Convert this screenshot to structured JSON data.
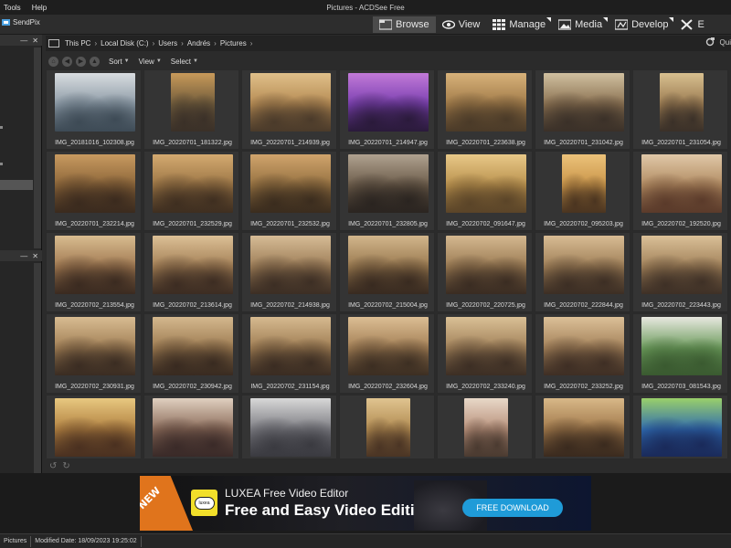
{
  "titlebar": {
    "menu": [
      "Tools",
      "Help"
    ],
    "title": "Pictures - ACDSee Free"
  },
  "toolbar": {
    "sendpix": "SendPix",
    "modes": [
      {
        "label": "Browse",
        "icon": "browse-icon",
        "active": true
      },
      {
        "label": "View",
        "icon": "eye-icon"
      },
      {
        "label": "Manage",
        "icon": "grid-icon"
      },
      {
        "label": "Media",
        "icon": "media-icon"
      },
      {
        "label": "Develop",
        "icon": "develop-icon"
      },
      {
        "label": "E",
        "icon": "edit-icon"
      }
    ]
  },
  "address": {
    "crumbs": [
      "This PC",
      "Local Disk (C:)",
      "Users",
      "Andrés",
      "Pictures"
    ],
    "quick_search": "Qui"
  },
  "nav": {
    "sort": "Sort",
    "view": "View",
    "select": "Select"
  },
  "files": [
    {
      "name": "IMG_20181016_102308.jpg",
      "orient": "land",
      "palette": [
        "#8c9aa6",
        "#d9dde0",
        "#3d4a55"
      ]
    },
    {
      "name": "IMG_20220701_181322.jpg",
      "orient": "port",
      "palette": [
        "#6e5a3a",
        "#c89a5a",
        "#3a3028"
      ]
    },
    {
      "name": "IMG_20220701_214939.jpg",
      "orient": "land",
      "palette": [
        "#b58a52",
        "#e0c08a",
        "#4a3a2a"
      ]
    },
    {
      "name": "IMG_20220701_214947.jpg",
      "orient": "land",
      "palette": [
        "#7a3fb0",
        "#c27ad8",
        "#2a1a3a"
      ]
    },
    {
      "name": "IMG_20220701_223638.jpg",
      "orient": "land",
      "palette": [
        "#a07a48",
        "#d8b27a",
        "#4a3a28"
      ]
    },
    {
      "name": "IMG_20220701_231042.jpg",
      "orient": "land",
      "palette": [
        "#8a7050",
        "#d0c0a0",
        "#3a3028"
      ]
    },
    {
      "name": "IMG_20220701_231054.jpg",
      "orient": "port",
      "palette": [
        "#9a7a50",
        "#d8c090",
        "#3a3028"
      ]
    },
    {
      "name": "IMG_20220701_232214.jpg",
      "orient": "land",
      "palette": [
        "#8a6438",
        "#c89a60",
        "#3a2a1e"
      ]
    },
    {
      "name": "IMG_20220701_232529.jpg",
      "orient": "land",
      "palette": [
        "#9a7444",
        "#d4aa70",
        "#3e2e20"
      ]
    },
    {
      "name": "IMG_20220701_232532.jpg",
      "orient": "land",
      "palette": [
        "#947040",
        "#d0a46c",
        "#3a2c1e"
      ]
    },
    {
      "name": "IMG_20220701_232805.jpg",
      "orient": "land",
      "palette": [
        "#6a5a48",
        "#b0a290",
        "#2a2420"
      ]
    },
    {
      "name": "IMG_20220702_091647.jpg",
      "orient": "land",
      "palette": [
        "#b8904c",
        "#e8c888",
        "#5a4428"
      ]
    },
    {
      "name": "IMG_20220702_095203.jpg",
      "orient": "port",
      "palette": [
        "#c89448",
        "#ecc27a",
        "#4a3420"
      ]
    },
    {
      "name": "IMG_20220702_192520.jpg",
      "orient": "land",
      "palette": [
        "#b08a60",
        "#e0c8a8",
        "#5a3a2a"
      ]
    },
    {
      "name": "IMG_20220702_213554.jpg",
      "orient": "land",
      "palette": [
        "#a07850",
        "#d8bc90",
        "#3a2a20"
      ]
    },
    {
      "name": "IMG_20220702_213614.jpg",
      "orient": "land",
      "palette": [
        "#a27e54",
        "#dcc096",
        "#3c2c22"
      ]
    },
    {
      "name": "IMG_20220702_214938.jpg",
      "orient": "land",
      "palette": [
        "#9c7c56",
        "#d6bc96",
        "#3c2e24"
      ]
    },
    {
      "name": "IMG_20220702_215004.jpg",
      "orient": "land",
      "palette": [
        "#98784e",
        "#d2b68c",
        "#382a20"
      ]
    },
    {
      "name": "IMG_20220702_220725.jpg",
      "orient": "land",
      "palette": [
        "#9a7a52",
        "#d4b890",
        "#3a2c22"
      ]
    },
    {
      "name": "IMG_20220702_222844.jpg",
      "orient": "land",
      "palette": [
        "#9e7e56",
        "#d8bc94",
        "#3c2e24"
      ]
    },
    {
      "name": "IMG_20220702_223443.jpg",
      "orient": "land",
      "palette": [
        "#a08058",
        "#dac098",
        "#3e3026"
      ]
    },
    {
      "name": "IMG_20220702_230931.jpg",
      "orient": "land",
      "palette": [
        "#a07e54",
        "#d8bc92",
        "#3a2c22"
      ]
    },
    {
      "name": "IMG_20220702_230942.jpg",
      "orient": "land",
      "palette": [
        "#9c7a50",
        "#d4b88e",
        "#382a20"
      ]
    },
    {
      "name": "IMG_20220702_231154.jpg",
      "orient": "land",
      "palette": [
        "#9e7c52",
        "#d6ba90",
        "#3a2c22"
      ]
    },
    {
      "name": "IMG_20220702_232604.jpg",
      "orient": "land",
      "palette": [
        "#a27e54",
        "#dcbe94",
        "#3c2e22"
      ]
    },
    {
      "name": "IMG_20220702_233240.jpg",
      "orient": "land",
      "palette": [
        "#a08058",
        "#dac096",
        "#3c2e24"
      ]
    },
    {
      "name": "IMG_20220702_233252.jpg",
      "orient": "land",
      "palette": [
        "#a28058",
        "#dcc098",
        "#3e2e24"
      ]
    },
    {
      "name": "IMG_20220703_081543.jpg",
      "orient": "land",
      "palette": [
        "#6a9a5a",
        "#e8e8e0",
        "#3a5a30"
      ]
    },
    {
      "name": "",
      "orient": "land",
      "palette": [
        "#b08040",
        "#e8c880",
        "#4a3020"
      ]
    },
    {
      "name": "",
      "orient": "land",
      "palette": [
        "#8a6a58",
        "#e0d0c0",
        "#3a2a28"
      ]
    },
    {
      "name": "",
      "orient": "land",
      "palette": [
        "#7a7a80",
        "#d8d8d8",
        "#3a3a40"
      ]
    },
    {
      "name": "",
      "orient": "port",
      "palette": [
        "#b08a50",
        "#e0c490",
        "#4a3424"
      ]
    },
    {
      "name": "",
      "orient": "port",
      "palette": [
        "#b8907a",
        "#e8d8c8",
        "#4a3a30"
      ]
    },
    {
      "name": "",
      "orient": "land",
      "palette": [
        "#a0784a",
        "#d8b888",
        "#3a2a1e"
      ]
    },
    {
      "name": "",
      "orient": "land",
      "palette": [
        "#2e6ab0",
        "#9ad06a",
        "#1a2a5a"
      ]
    }
  ],
  "banner": {
    "ribbon": "NEW",
    "logo_text": "luxea",
    "line1": "LUXEA Free Video Editor",
    "line2": "Free and Easy Video Editing",
    "cta": "FREE DOWNLOAD"
  },
  "status": {
    "folder": "Pictures",
    "modified": "Modified Date: 18/09/2023 19:25:02"
  }
}
